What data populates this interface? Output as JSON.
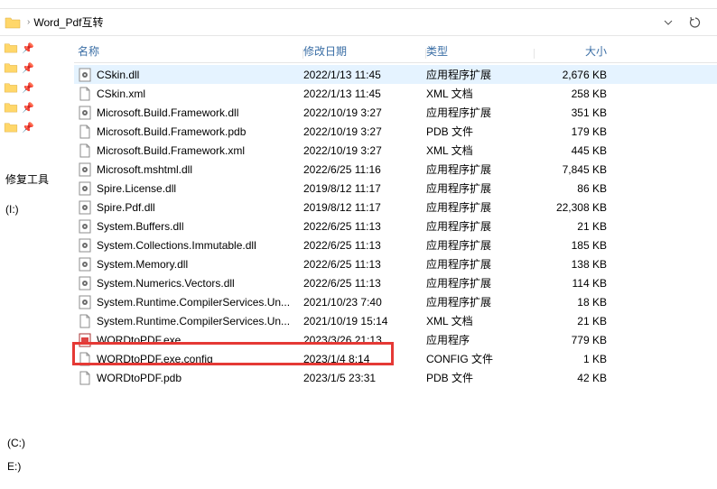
{
  "breadcrumb": {
    "folder": "Word_Pdf互转"
  },
  "left": {
    "repair_tool": "修复工具",
    "drive_i": "(I:)",
    "drive_c": "(C:)",
    "drive_e": "E:)"
  },
  "columns": {
    "name": "名称",
    "date": "修改日期",
    "type": "类型",
    "size": "大小"
  },
  "files": [
    {
      "name": "CSkin.dll",
      "date": "2022/1/13 11:45",
      "type": "应用程序扩展",
      "size": "2,676 KB",
      "icon": "gear",
      "hover": true
    },
    {
      "name": "CSkin.xml",
      "date": "2022/1/13 11:45",
      "type": "XML 文档",
      "size": "258 KB",
      "icon": "doc"
    },
    {
      "name": "Microsoft.Build.Framework.dll",
      "date": "2022/10/19 3:27",
      "type": "应用程序扩展",
      "size": "351 KB",
      "icon": "gear"
    },
    {
      "name": "Microsoft.Build.Framework.pdb",
      "date": "2022/10/19 3:27",
      "type": "PDB 文件",
      "size": "179 KB",
      "icon": "doc"
    },
    {
      "name": "Microsoft.Build.Framework.xml",
      "date": "2022/10/19 3:27",
      "type": "XML 文档",
      "size": "445 KB",
      "icon": "doc"
    },
    {
      "name": "Microsoft.mshtml.dll",
      "date": "2022/6/25 11:16",
      "type": "应用程序扩展",
      "size": "7,845 KB",
      "icon": "gear"
    },
    {
      "name": "Spire.License.dll",
      "date": "2019/8/12 11:17",
      "type": "应用程序扩展",
      "size": "86 KB",
      "icon": "gear"
    },
    {
      "name": "Spire.Pdf.dll",
      "date": "2019/8/12 11:17",
      "type": "应用程序扩展",
      "size": "22,308 KB",
      "icon": "gear"
    },
    {
      "name": "System.Buffers.dll",
      "date": "2022/6/25 11:13",
      "type": "应用程序扩展",
      "size": "21 KB",
      "icon": "gear"
    },
    {
      "name": "System.Collections.Immutable.dll",
      "date": "2022/6/25 11:13",
      "type": "应用程序扩展",
      "size": "185 KB",
      "icon": "gear"
    },
    {
      "name": "System.Memory.dll",
      "date": "2022/6/25 11:13",
      "type": "应用程序扩展",
      "size": "138 KB",
      "icon": "gear"
    },
    {
      "name": "System.Numerics.Vectors.dll",
      "date": "2022/6/25 11:13",
      "type": "应用程序扩展",
      "size": "114 KB",
      "icon": "gear"
    },
    {
      "name": "System.Runtime.CompilerServices.Un...",
      "date": "2021/10/23 7:40",
      "type": "应用程序扩展",
      "size": "18 KB",
      "icon": "gear"
    },
    {
      "name": "System.Runtime.CompilerServices.Un...",
      "date": "2021/10/19 15:14",
      "type": "XML 文档",
      "size": "21 KB",
      "icon": "doc"
    },
    {
      "name": "WORDtoPDF.exe",
      "date": "2023/3/26 21:13",
      "type": "应用程序",
      "size": "779 KB",
      "icon": "exe"
    },
    {
      "name": "WORDtoPDF.exe.config",
      "date": "2023/1/4 8:14",
      "type": "CONFIG 文件",
      "size": "1 KB",
      "icon": "doc"
    },
    {
      "name": "WORDtoPDF.pdb",
      "date": "2023/1/5 23:31",
      "type": "PDB 文件",
      "size": "42 KB",
      "icon": "doc"
    }
  ]
}
